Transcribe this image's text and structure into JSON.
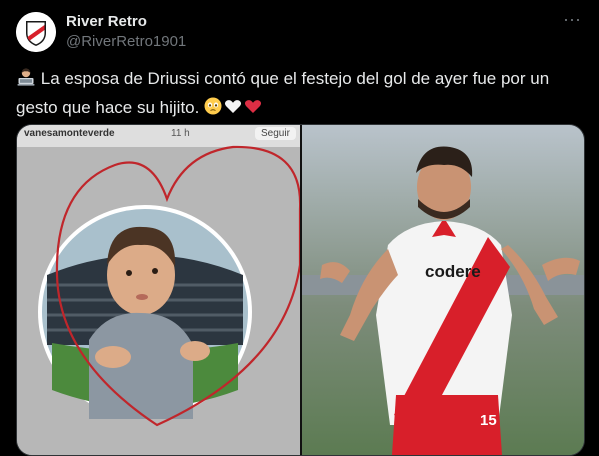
{
  "author": {
    "display_name": "River Retro",
    "handle": "@RiverRetro1901",
    "avatar_icon": "river-plate-crest-icon"
  },
  "tweet": {
    "lead_emoji": "👨‍💻",
    "text": "La esposa de Driussi contó que el festejo del gol de ayer fue por un gesto que hace su hijito.",
    "trailing_emojis": "🥹🤍❤️"
  },
  "menu": {
    "more_label": "···"
  },
  "media": {
    "story": {
      "username": "vanesamonteverde",
      "time": "11 h",
      "follow_label": "Seguir"
    },
    "shirt_sponsor": "codere",
    "shirt_number": "15",
    "colors": {
      "heart_outline": "#c0262b",
      "kit_red": "#d81f2a",
      "kit_white": "#f4f4f4"
    }
  }
}
